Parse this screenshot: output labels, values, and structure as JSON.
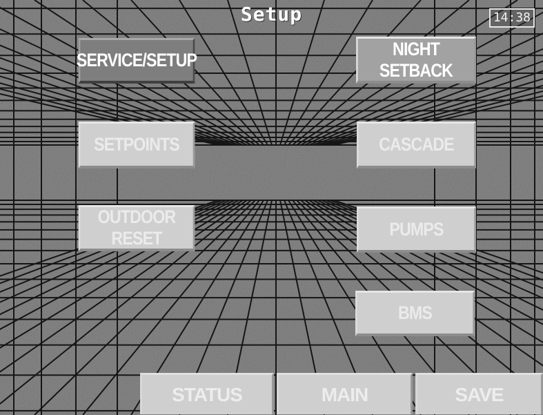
{
  "screen": {
    "title": "Setup",
    "clock": "14:38"
  },
  "menu": {
    "service_setup": "SERVICE/SETUP",
    "night_setback": "NIGHT SETBACK",
    "setpoints": "SETPOINTS",
    "cascade": "CASCADE",
    "outdoor_reset": "OUTDOOR RESET",
    "pumps": "PUMPS",
    "bms": "BMS"
  },
  "softkeys": {
    "status": "STATUS",
    "main": "MAIN",
    "save": "SAVE"
  },
  "colors": {
    "background": "#6e6e6e",
    "grid_lines": "#151515",
    "button_face": "#cfcfcf",
    "button_active": "#7e7e7e"
  }
}
